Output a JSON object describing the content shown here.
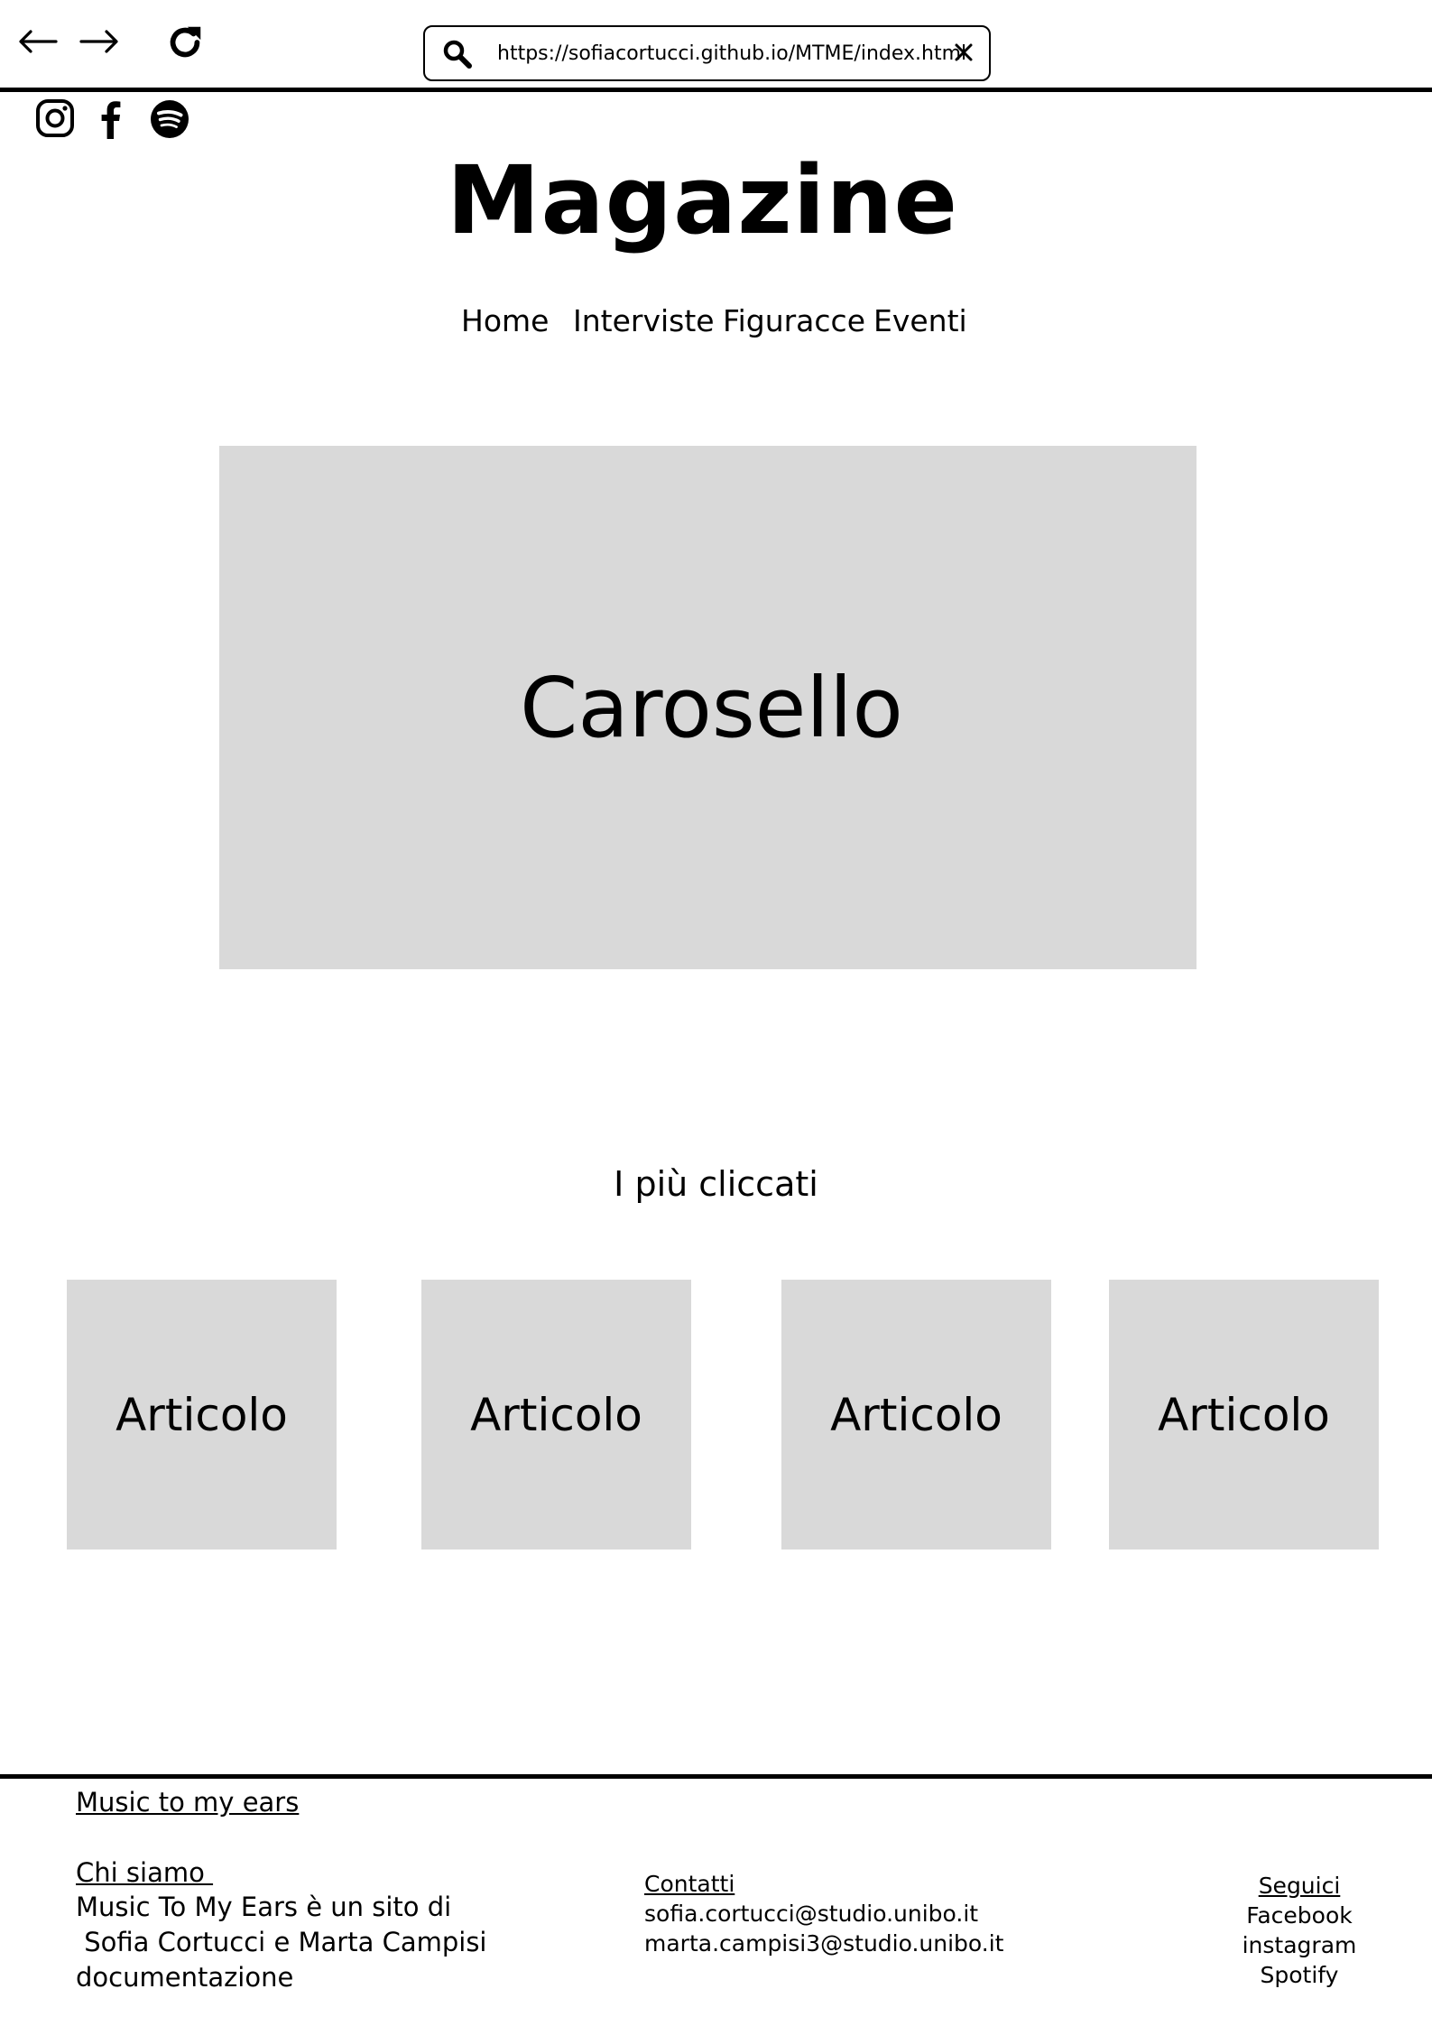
{
  "browser": {
    "url": "https://sofiacortucci.github.io/MTME/index.html"
  },
  "icons": {
    "back": "arrow-left-icon",
    "forward": "arrow-right-icon",
    "reload": "reload-icon",
    "search": "search-icon",
    "clear": "close-icon",
    "instagram": "instagram-icon",
    "facebook": "facebook-icon",
    "spotify": "spotify-icon"
  },
  "header": {
    "title": "Magazine"
  },
  "nav": {
    "items": [
      {
        "label": "Home"
      },
      {
        "label": "Interviste"
      },
      {
        "label": "Figuracce"
      },
      {
        "label": "Eventi"
      }
    ]
  },
  "carousel": {
    "label": "Carosello"
  },
  "most_clicked": {
    "heading": "I più cliccati",
    "articles": [
      {
        "label": "Articolo"
      },
      {
        "label": "Articolo"
      },
      {
        "label": "Articolo"
      },
      {
        "label": "Articolo"
      }
    ]
  },
  "footer": {
    "brand": "Music to my ears",
    "about_title": "Chi siamo ",
    "about_line1": "Music To My Ears è un sito di",
    "about_line2": " Sofia Cortucci e Marta Campisi",
    "docs": "documentazione",
    "contacts_title": "Contatti",
    "emails": [
      "sofia.cortucci@studio.unibo.it",
      "marta.campisi3@studio.unibo.it"
    ],
    "follow_title": "Seguici",
    "follow_links": [
      "Facebook",
      "instagram",
      "Spotify"
    ]
  },
  "colors": {
    "placeholder_gray": "#d9d9d9",
    "text": "#000000",
    "background": "#ffffff"
  }
}
